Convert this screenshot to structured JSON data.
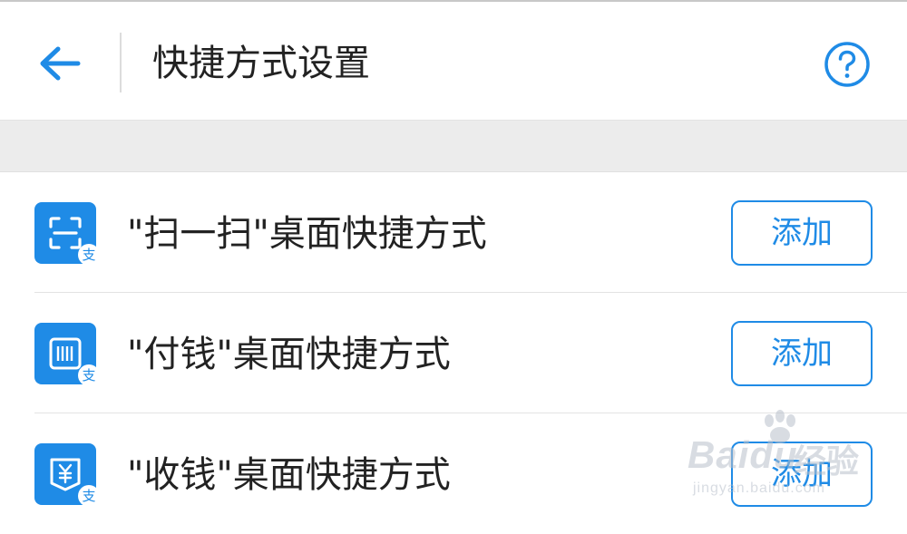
{
  "header": {
    "title": "快捷方式设置",
    "back_icon": "arrow-left-icon",
    "help_icon": "question-circle-icon"
  },
  "colors": {
    "accent": "#1f8be6",
    "text": "#222222",
    "band": "#ececec",
    "separator": "#e3e3e3"
  },
  "shortcuts": [
    {
      "icon": "scan-icon",
      "label": "\"扫一扫\"桌面快捷方式",
      "button": "添加"
    },
    {
      "icon": "barcode-icon",
      "label": "\"付钱\"桌面快捷方式",
      "button": "添加"
    },
    {
      "icon": "yuan-receipt-icon",
      "label": "\"收钱\"桌面快捷方式",
      "button": "添加"
    }
  ],
  "badge_glyph": "支",
  "watermark": {
    "brand": "Baidu",
    "brand_cn": "经验",
    "url": "jingyan.baidu.com"
  }
}
